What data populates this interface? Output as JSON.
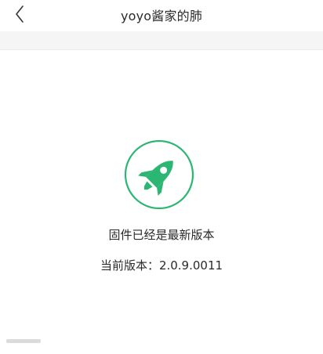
{
  "header": {
    "title": "yoyo酱家的肺",
    "back_icon": "chevron-left-icon"
  },
  "firmware": {
    "status_icon": "rocket-icon",
    "status_text": "固件已经是最新版本",
    "version_text": "当前版本：2.0.9.0011",
    "accent_color": "#2bb673"
  }
}
